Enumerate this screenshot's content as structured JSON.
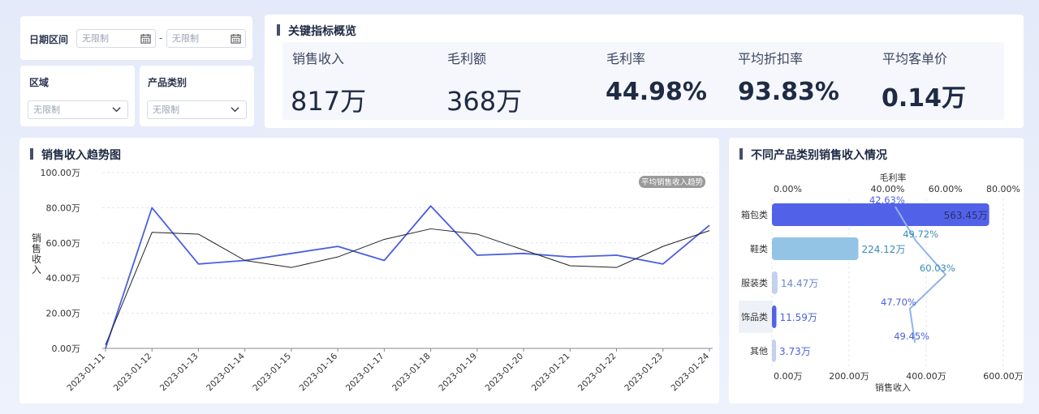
{
  "filters": {
    "date_label": "日期区间",
    "date_start_placeholder": "无限制",
    "date_end_placeholder": "无限制",
    "date_separator": "-",
    "region_label": "区域",
    "region_value": "无限制",
    "category_label": "产品类别",
    "category_value": "无限制"
  },
  "kpi": {
    "title": "关键指标概览",
    "items": [
      {
        "label": "销售收入",
        "value": "817万"
      },
      {
        "label": "毛利额",
        "value": "368万"
      },
      {
        "label": "毛利率",
        "value": "44.98%"
      },
      {
        "label": "平均折扣率",
        "value": "93.83%"
      },
      {
        "label": "平均客单价",
        "value": "0.14万"
      }
    ]
  },
  "trend": {
    "title": "销售收入趋势图",
    "legend_badge": "平均销售收入趋势",
    "y_label": "销售收入"
  },
  "category": {
    "title": "不同产品类别销售收入情况"
  },
  "colors": {
    "primary_blue": "#4a5fe0",
    "bar_purple": "#5262e8",
    "bar_light_blue": "#8fc3e6",
    "bar_pale": "#c3d0ef",
    "text_dark": "#1f2a44"
  },
  "chart_data": [
    {
      "type": "line",
      "x": [
        "2023-01-11",
        "2023-01-12",
        "2023-01-13",
        "2023-01-14",
        "2023-01-15",
        "2023-01-16",
        "2023-01-17",
        "2023-01-18",
        "2023-01-19",
        "2023-01-20",
        "2023-01-21",
        "2023-01-22",
        "2023-01-23",
        "2023-01-24"
      ],
      "series": [
        {
          "values": [
            0,
            80,
            48,
            50,
            54,
            58,
            50,
            81,
            53,
            54,
            52,
            53,
            48,
            70
          ]
        },
        {
          "name": "平均销售收入趋势",
          "values": [
            2,
            66,
            65,
            50,
            46,
            52,
            62,
            68,
            65,
            56,
            47,
            46,
            58,
            67
          ]
        }
      ],
      "y_ticks": [
        "0.00万",
        "20.00万",
        "40.00万",
        "60.00万",
        "80.00万",
        "100.00万"
      ],
      "ylim": [
        0,
        100
      ],
      "ylabel": "销售收入",
      "grid": true
    },
    {
      "type": "bar",
      "orientation": "horizontal",
      "categories": [
        "箱包类",
        "鞋类",
        "服装类",
        "饰品类",
        "其他"
      ],
      "values": [
        563.45,
        224.12,
        14.47,
        11.59,
        3.73
      ],
      "value_labels": [
        "563.45万",
        "224.12万",
        "14.47万",
        "11.59万",
        "3.73万"
      ],
      "bar_colors": [
        "#5262e8",
        "#93c4e6",
        "#c3d0ef",
        "#5262e8",
        "#c3d0ef"
      ],
      "xlabel": "销售收入",
      "x_ticks": [
        "0.00万",
        "200.00万",
        "400.00万",
        "600.00万"
      ],
      "xlim": [
        0,
        600
      ],
      "secondary": {
        "type": "line",
        "label": "毛利率",
        "values": [
          42.63,
          49.72,
          60.03,
          47.7,
          49.45
        ],
        "value_labels": [
          "42.63%",
          "49.72%",
          "60.03%",
          "47.70%",
          "49.45%"
        ],
        "ticks": [
          "0.00%",
          "40.00%",
          "60.00%",
          "80.00%"
        ],
        "tick_values": [
          0,
          40,
          60,
          80
        ],
        "range": [
          0,
          80
        ]
      }
    }
  ]
}
